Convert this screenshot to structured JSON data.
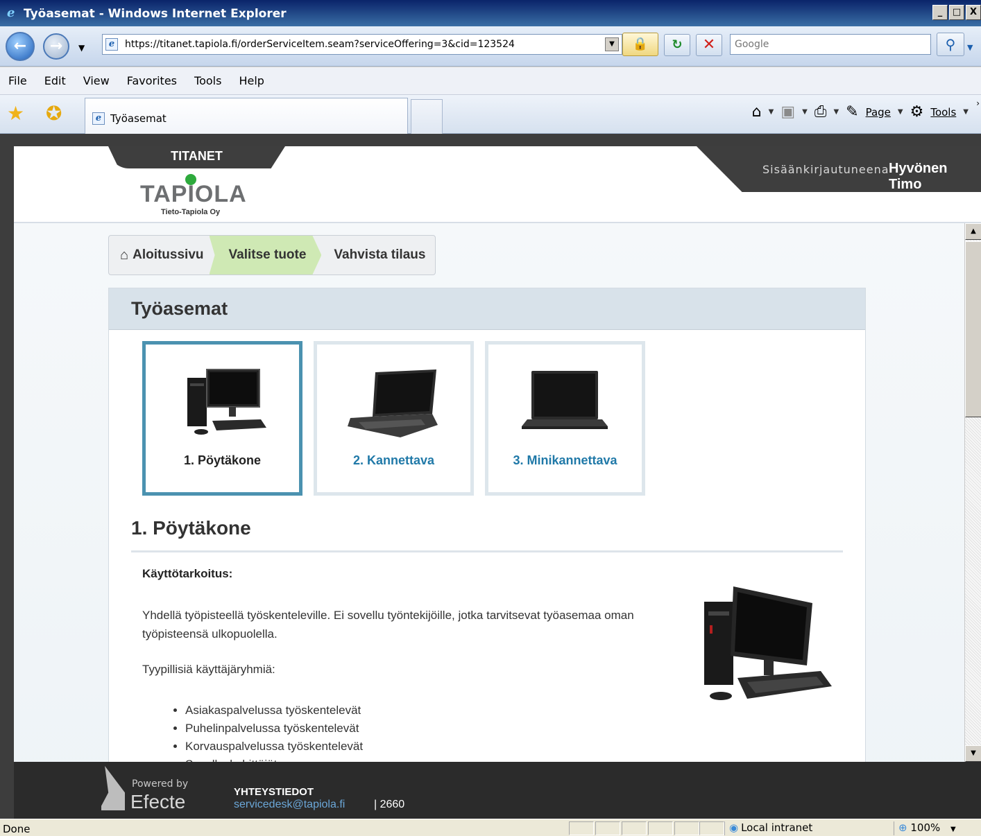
{
  "window": {
    "title": "Työasemat - Windows Internet Explorer",
    "min": "_",
    "max": "□",
    "close": "X"
  },
  "address": {
    "url": "https://titanet.tapiola.fi/orderServiceItem.seam?serviceOffering=3&cid=123524"
  },
  "search": {
    "placeholder": "Google"
  },
  "menu": {
    "items": [
      "File",
      "Edit",
      "View",
      "Favorites",
      "Tools",
      "Help"
    ]
  },
  "tab": {
    "label": "Työasemat"
  },
  "commandbar": {
    "page": "Page",
    "tools": "Tools"
  },
  "header": {
    "titanet": "TITANET",
    "logo_word": "TAPIOLA",
    "logo_sub": "Tieto-Tapiola Oy",
    "logged_in_prefix": "Sisäänkirjautuneena",
    "user_name": "Hyvönen Timo"
  },
  "breadcrumbs": {
    "home": "Aloitussivu",
    "active": "Valitse tuote",
    "last": "Vahvista tilaus"
  },
  "panel": {
    "title": "Työasemat"
  },
  "cards": [
    {
      "label": "1. Pöytäkone",
      "selected": true,
      "icon": "desktop-computer-icon"
    },
    {
      "label": "2. Kannettava",
      "selected": false,
      "icon": "laptop-icon"
    },
    {
      "label": "3. Minikannettava",
      "selected": false,
      "icon": "mini-laptop-icon"
    }
  ],
  "detail": {
    "title": "1. Pöytäkone",
    "purpose_label": "Käyttötarkoitus:",
    "purpose_text": "Yhdellä työpisteellä työskenteleville. Ei sovellu työntekijöille, jotka tarvitsevat työasemaa oman työpisteensä ulkopuolella.",
    "groups_label": "Tyypillisiä käyttäjäryhmiä:",
    "groups": [
      "Asiakaspalvelussa työskentelevät",
      "Puhelinpalvelussa työskentelevät",
      "Korvauspalvelussa työskentelevät",
      "Sovelluskehittäjät"
    ]
  },
  "footer": {
    "powered_by": "Powered by",
    "brand": "Efecte",
    "contact_title": "YHTEYSTIEDOT",
    "email": "servicedesk@tapiola.fi",
    "phone": "| 2660"
  },
  "statusbar": {
    "status": "Done",
    "zone": "Local intranet",
    "zoom": "100%"
  }
}
